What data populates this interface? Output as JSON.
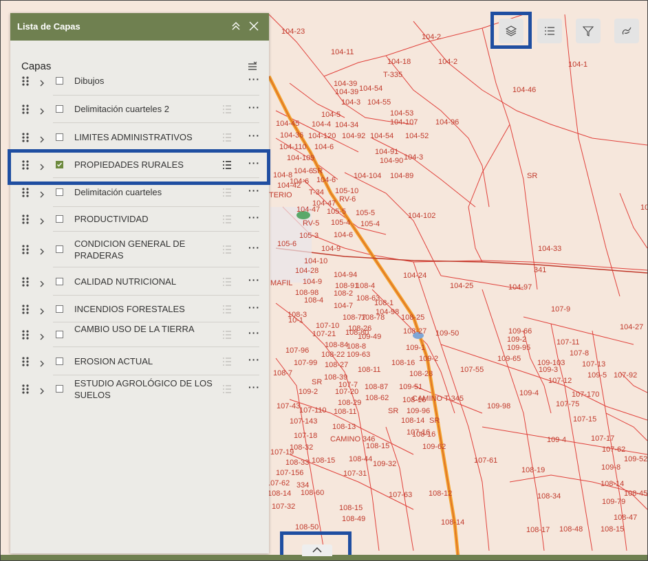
{
  "panel": {
    "title": "Lista de Capas",
    "layers_heading": "Capas",
    "layers": [
      {
        "label": "Dibujos",
        "checked": false,
        "has_legend": false
      },
      {
        "label": "Delimitación cuarteles 2",
        "checked": false,
        "has_legend": true
      },
      {
        "label": "LIMITES ADMINISTRATIVOS",
        "checked": false,
        "has_legend": true
      },
      {
        "label": "PROPIEDADES RURALES",
        "checked": true,
        "has_legend": true
      },
      {
        "label": "Delimitación cuarteles",
        "checked": false,
        "has_legend": true
      },
      {
        "label": "PRODUCTIVIDAD",
        "checked": false,
        "has_legend": true
      },
      {
        "label": "CONDICION GENERAL DE PRADERAS",
        "checked": false,
        "has_legend": true
      },
      {
        "label": "CALIDAD NUTRICIONAL",
        "checked": false,
        "has_legend": true
      },
      {
        "label": "INCENDIOS FORESTALES",
        "checked": false,
        "has_legend": true
      },
      {
        "label": "CAMBIO USO DE LA TIERRA",
        "checked": false,
        "has_legend": true
      },
      {
        "label": "EROSION ACTUAL",
        "checked": false,
        "has_legend": true
      },
      {
        "label": "ESTUDIO AGROLÓGICO DE LOS SUELOS",
        "checked": false,
        "has_legend": true
      }
    ],
    "more_label": "···"
  },
  "toolbar": {
    "icons": [
      "layers-icon",
      "legend-list-icon",
      "filter-icon",
      "basemap-style-icon"
    ]
  },
  "map": {
    "road_labels": [
      "CAMINO T-345",
      "CAMINO 346",
      "341",
      "T-335",
      "SR",
      "RV-5",
      "RV-6",
      "T-34"
    ],
    "parcel_labels": [
      "104-23",
      "104-2",
      "104-11",
      "104-18",
      "104-2",
      "104-1",
      "T-335",
      "104-39",
      "104-39",
      "104-54",
      "104-46",
      "104-3",
      "104-55",
      "104-5",
      "104-53",
      "104-45",
      "104-4",
      "104-34",
      "104-107",
      "104-96",
      "104-36",
      "104-120",
      "104-92",
      "104-54",
      "104-52",
      "104-110",
      "104-6",
      "104-91",
      "104-109",
      "104-3",
      "104-90",
      "104-8",
      "104-6",
      "SR",
      "104-6",
      "104-89",
      "104-104",
      "SR",
      "104-6",
      "104-42",
      "T-34",
      "105-10",
      "TERIO",
      "104-47",
      "RV-6",
      "104",
      "104-47",
      "105-5",
      "105-5",
      "104-102",
      "RV-5",
      "105-4",
      "105-4",
      "105-3",
      "104-6",
      "105-6",
      "104-9",
      "104-33",
      "104-10",
      "104-28",
      "104-94",
      "104-24",
      "341",
      "MAFIL",
      "104-9",
      "108-91",
      "108-4",
      "104-25",
      "104-97",
      "108-98",
      "108-2",
      "108-63",
      "108-1",
      "108-4",
      "104-7",
      "104-98",
      "107-9",
      "108-3",
      "108-77",
      "108-25",
      "109-66",
      "104-27",
      "10-1",
      "107-10",
      "108-78",
      "108-26",
      "108-27",
      "109-50",
      "109-2",
      "107-11",
      "107-21",
      "108-80",
      "109-49",
      "109-95",
      "107-8",
      "107-96",
      "108-84",
      "108-8",
      "109-1",
      "109-65",
      "109-103",
      "107-13",
      "108-22",
      "109-63",
      "109-3",
      "109-5",
      "107-92",
      "107-99",
      "108-27",
      "108-11",
      "108-16",
      "109-2",
      "107-55",
      "107-12",
      "108-7",
      "108-39",
      "SR",
      "108-28",
      "108-87",
      "109-51",
      "109-4",
      "107-170",
      "107-20",
      "109-2",
      "107-7",
      "107-43",
      "108-29",
      "108-62",
      "108-16",
      "CAMINO T-345",
      "109-98",
      "107-75",
      "107-110",
      "108-11",
      "SR",
      "109-96",
      "107-15",
      "107-143",
      "108-13",
      "108-14",
      "SR",
      "107-16",
      "107-18",
      "CAMINO 346",
      "108-16",
      "109-4",
      "107-17",
      "108-32",
      "108-15",
      "109-62",
      "107-62",
      "107-19",
      "108-33",
      "108-15",
      "108-44",
      "109-32",
      "107-61",
      "108-19",
      "109-52",
      "107-156",
      "107-31",
      "109-8",
      "107-62",
      "334",
      "108-14",
      "108-14",
      "108-60",
      "108-45",
      "107-63",
      "108-12",
      "108-34",
      "109-79",
      "107-32",
      "108-15",
      "108-49",
      "108-47",
      "108-50",
      "108-14",
      "108-17",
      "108-48",
      "108-15"
    ]
  }
}
